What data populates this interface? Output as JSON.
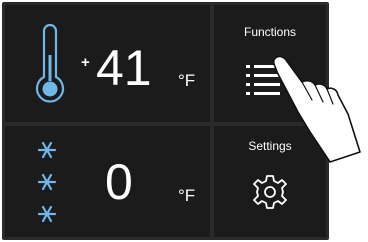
{
  "fridge": {
    "sign": "+",
    "temperature": "41",
    "unit": "°F",
    "icon": "thermometer-icon"
  },
  "freezer": {
    "temperature": "0",
    "unit": "°F",
    "icon": "snowflake-icon"
  },
  "functions": {
    "label": "Functions",
    "icon": "list-menu-icon"
  },
  "settings": {
    "label": "Settings",
    "icon": "gear-icon"
  },
  "overlay": {
    "icon": "pointing-hand-icon"
  },
  "colors": {
    "panel": "#2a2a2a",
    "tile": "#1b1b1b",
    "text": "#ffffff",
    "accent": "#6fb7e6"
  }
}
